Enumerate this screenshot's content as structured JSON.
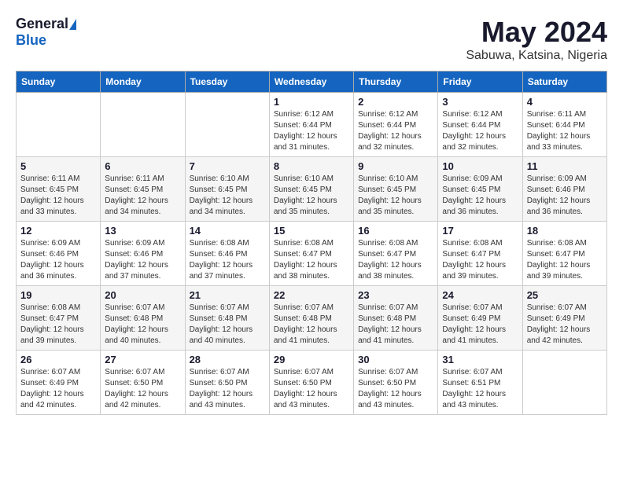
{
  "header": {
    "logo_general": "General",
    "logo_blue": "Blue",
    "month": "May 2024",
    "location": "Sabuwa, Katsina, Nigeria"
  },
  "weekdays": [
    "Sunday",
    "Monday",
    "Tuesday",
    "Wednesday",
    "Thursday",
    "Friday",
    "Saturday"
  ],
  "weeks": [
    [
      {
        "day": "",
        "info": ""
      },
      {
        "day": "",
        "info": ""
      },
      {
        "day": "",
        "info": ""
      },
      {
        "day": "1",
        "info": "Sunrise: 6:12 AM\nSunset: 6:44 PM\nDaylight: 12 hours\nand 31 minutes."
      },
      {
        "day": "2",
        "info": "Sunrise: 6:12 AM\nSunset: 6:44 PM\nDaylight: 12 hours\nand 32 minutes."
      },
      {
        "day": "3",
        "info": "Sunrise: 6:12 AM\nSunset: 6:44 PM\nDaylight: 12 hours\nand 32 minutes."
      },
      {
        "day": "4",
        "info": "Sunrise: 6:11 AM\nSunset: 6:44 PM\nDaylight: 12 hours\nand 33 minutes."
      }
    ],
    [
      {
        "day": "5",
        "info": "Sunrise: 6:11 AM\nSunset: 6:45 PM\nDaylight: 12 hours\nand 33 minutes."
      },
      {
        "day": "6",
        "info": "Sunrise: 6:11 AM\nSunset: 6:45 PM\nDaylight: 12 hours\nand 34 minutes."
      },
      {
        "day": "7",
        "info": "Sunrise: 6:10 AM\nSunset: 6:45 PM\nDaylight: 12 hours\nand 34 minutes."
      },
      {
        "day": "8",
        "info": "Sunrise: 6:10 AM\nSunset: 6:45 PM\nDaylight: 12 hours\nand 35 minutes."
      },
      {
        "day": "9",
        "info": "Sunrise: 6:10 AM\nSunset: 6:45 PM\nDaylight: 12 hours\nand 35 minutes."
      },
      {
        "day": "10",
        "info": "Sunrise: 6:09 AM\nSunset: 6:45 PM\nDaylight: 12 hours\nand 36 minutes."
      },
      {
        "day": "11",
        "info": "Sunrise: 6:09 AM\nSunset: 6:46 PM\nDaylight: 12 hours\nand 36 minutes."
      }
    ],
    [
      {
        "day": "12",
        "info": "Sunrise: 6:09 AM\nSunset: 6:46 PM\nDaylight: 12 hours\nand 36 minutes."
      },
      {
        "day": "13",
        "info": "Sunrise: 6:09 AM\nSunset: 6:46 PM\nDaylight: 12 hours\nand 37 minutes."
      },
      {
        "day": "14",
        "info": "Sunrise: 6:08 AM\nSunset: 6:46 PM\nDaylight: 12 hours\nand 37 minutes."
      },
      {
        "day": "15",
        "info": "Sunrise: 6:08 AM\nSunset: 6:47 PM\nDaylight: 12 hours\nand 38 minutes."
      },
      {
        "day": "16",
        "info": "Sunrise: 6:08 AM\nSunset: 6:47 PM\nDaylight: 12 hours\nand 38 minutes."
      },
      {
        "day": "17",
        "info": "Sunrise: 6:08 AM\nSunset: 6:47 PM\nDaylight: 12 hours\nand 39 minutes."
      },
      {
        "day": "18",
        "info": "Sunrise: 6:08 AM\nSunset: 6:47 PM\nDaylight: 12 hours\nand 39 minutes."
      }
    ],
    [
      {
        "day": "19",
        "info": "Sunrise: 6:08 AM\nSunset: 6:47 PM\nDaylight: 12 hours\nand 39 minutes."
      },
      {
        "day": "20",
        "info": "Sunrise: 6:07 AM\nSunset: 6:48 PM\nDaylight: 12 hours\nand 40 minutes."
      },
      {
        "day": "21",
        "info": "Sunrise: 6:07 AM\nSunset: 6:48 PM\nDaylight: 12 hours\nand 40 minutes."
      },
      {
        "day": "22",
        "info": "Sunrise: 6:07 AM\nSunset: 6:48 PM\nDaylight: 12 hours\nand 41 minutes."
      },
      {
        "day": "23",
        "info": "Sunrise: 6:07 AM\nSunset: 6:48 PM\nDaylight: 12 hours\nand 41 minutes."
      },
      {
        "day": "24",
        "info": "Sunrise: 6:07 AM\nSunset: 6:49 PM\nDaylight: 12 hours\nand 41 minutes."
      },
      {
        "day": "25",
        "info": "Sunrise: 6:07 AM\nSunset: 6:49 PM\nDaylight: 12 hours\nand 42 minutes."
      }
    ],
    [
      {
        "day": "26",
        "info": "Sunrise: 6:07 AM\nSunset: 6:49 PM\nDaylight: 12 hours\nand 42 minutes."
      },
      {
        "day": "27",
        "info": "Sunrise: 6:07 AM\nSunset: 6:50 PM\nDaylight: 12 hours\nand 42 minutes."
      },
      {
        "day": "28",
        "info": "Sunrise: 6:07 AM\nSunset: 6:50 PM\nDaylight: 12 hours\nand 43 minutes."
      },
      {
        "day": "29",
        "info": "Sunrise: 6:07 AM\nSunset: 6:50 PM\nDaylight: 12 hours\nand 43 minutes."
      },
      {
        "day": "30",
        "info": "Sunrise: 6:07 AM\nSunset: 6:50 PM\nDaylight: 12 hours\nand 43 minutes."
      },
      {
        "day": "31",
        "info": "Sunrise: 6:07 AM\nSunset: 6:51 PM\nDaylight: 12 hours\nand 43 minutes."
      },
      {
        "day": "",
        "info": ""
      }
    ]
  ]
}
